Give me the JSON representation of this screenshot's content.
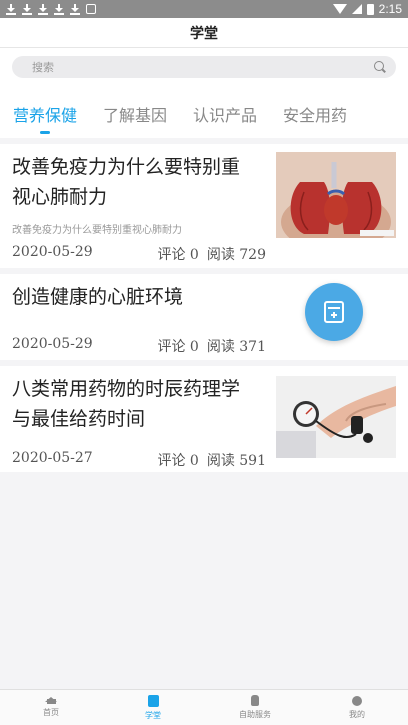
{
  "status": {
    "time": "2:15"
  },
  "header": {
    "title": "学堂"
  },
  "search": {
    "placeholder": "搜索"
  },
  "tabs": [
    {
      "label": "营养保健",
      "active": true
    },
    {
      "label": "了解基因",
      "active": false
    },
    {
      "label": "认识产品",
      "active": false
    },
    {
      "label": "安全用药",
      "active": false
    }
  ],
  "articles": [
    {
      "title_line1": "改善免疫力为什么要特别重",
      "title_line2": "视心肺耐力",
      "summary": "改善免疫力为什么要特别重视心肺耐力",
      "date": "2020-05-29",
      "comments": "评论 0",
      "reads": "阅读 729"
    },
    {
      "title_line1": "创造健康的心脏环境",
      "date": "2020-05-29",
      "comments": "评论 0",
      "reads": "阅读 371"
    },
    {
      "title_line1": "八类常用药物的时辰药理学",
      "title_line2": "与最佳给药时间",
      "date": "2020-05-27",
      "comments": "评论 0",
      "reads": "阅读 591"
    }
  ],
  "nav": [
    {
      "label": "首页",
      "icon": "home-icon"
    },
    {
      "label": "学堂",
      "icon": "book-icon"
    },
    {
      "label": "自助服务",
      "icon": "hand-icon"
    },
    {
      "label": "我的",
      "icon": "person-icon"
    }
  ],
  "colors": {
    "accent": "#1aa3e8",
    "fab": "#4ba9e5"
  }
}
